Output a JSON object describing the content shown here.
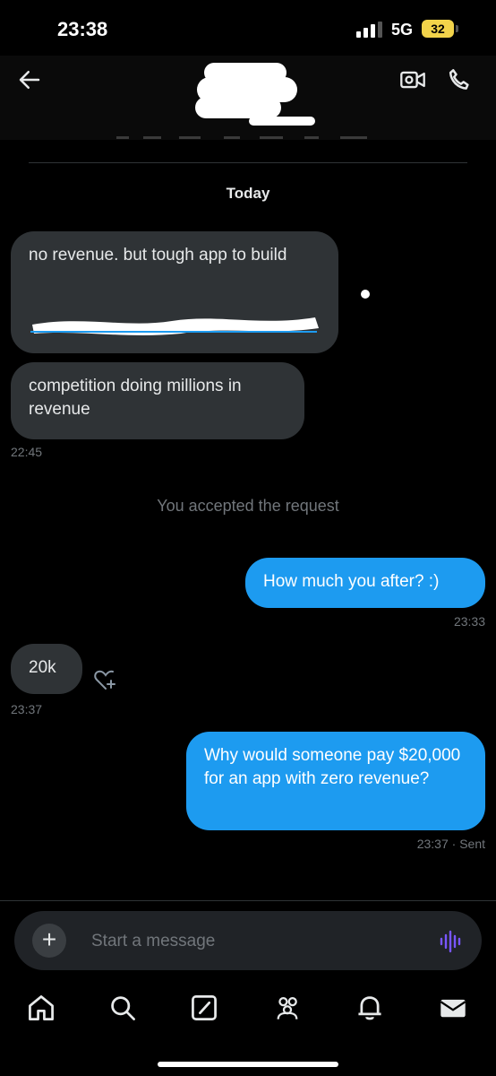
{
  "status_bar": {
    "time": "23:38",
    "network": "5G",
    "battery": "32"
  },
  "header": {
    "back_icon": "arrow-left-icon",
    "video_icon": "video-call-icon",
    "call_icon": "phone-icon"
  },
  "conversation": {
    "date_separator": "Today",
    "messages_in_1": {
      "text1": "no revenue. but tough app to build",
      "text2": "competition doing millions in revenue",
      "time": "22:45"
    },
    "system_note": "You accepted the request",
    "message_out_1": {
      "text": "How much you after? :)",
      "time": "23:33"
    },
    "message_in_2": {
      "text": "20k",
      "time": "23:37"
    },
    "message_out_2": {
      "text": "Why would someone pay $20,000 for an app with zero revenue?",
      "time": "23:37 · Sent"
    }
  },
  "composer": {
    "placeholder": "Start a message",
    "plus_label": "+"
  },
  "nav": [
    "home-icon",
    "search-icon",
    "compose-icon",
    "communities-icon",
    "notifications-icon",
    "messages-icon"
  ],
  "colors": {
    "accent": "#1d9bf0",
    "bubble_in": "#2f3336",
    "voice": "#7856ff"
  }
}
